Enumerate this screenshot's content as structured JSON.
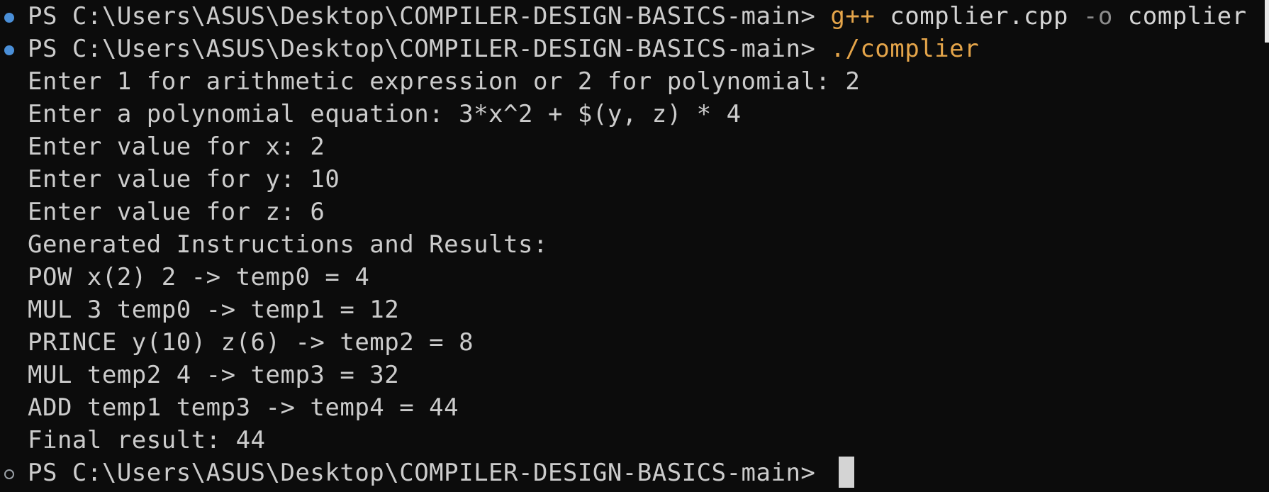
{
  "terminal": {
    "lines": [
      {
        "marker": "filled",
        "prompt": "PS C:\\Users\\ASUS\\Desktop\\COMPILER-DESIGN-BASICS-main> ",
        "command": "g++",
        "args1": " complier.cpp ",
        "flag": "-o",
        "args2": " complier"
      },
      {
        "marker": "filled",
        "prompt": "PS C:\\Users\\ASUS\\Desktop\\COMPILER-DESIGN-BASICS-main> ",
        "command": "./complier"
      },
      {
        "text": "Enter 1 for arithmetic expression or 2 for polynomial: 2"
      },
      {
        "text": "Enter a polynomial equation: 3*x^2 + $(y, z) * 4"
      },
      {
        "text": "Enter value for x: 2"
      },
      {
        "text": "Enter value for y: 10"
      },
      {
        "text": "Enter value for z: 6"
      },
      {
        "text": "Generated Instructions and Results:"
      },
      {
        "text": "POW x(2) 2 -> temp0 = 4"
      },
      {
        "text": "MUL 3 temp0 -> temp1 = 12"
      },
      {
        "text": "PRINCE y(10) z(6) -> temp2 = 8"
      },
      {
        "text": "MUL temp2 4 -> temp3 = 32"
      },
      {
        "text": "ADD temp1 temp3 -> temp4 = 44"
      },
      {
        "text": "Final result: 44"
      },
      {
        "marker": "hollow",
        "prompt": "PS C:\\Users\\ASUS\\Desktop\\COMPILER-DESIGN-BASICS-main> "
      }
    ]
  },
  "colors": {
    "background": "#0c0c0c",
    "text": "#cccccc",
    "command": "#e5a54a",
    "flag": "#8c8c8c",
    "marker_success": "#4a8fd8",
    "cursor": "#d4d4d4"
  }
}
